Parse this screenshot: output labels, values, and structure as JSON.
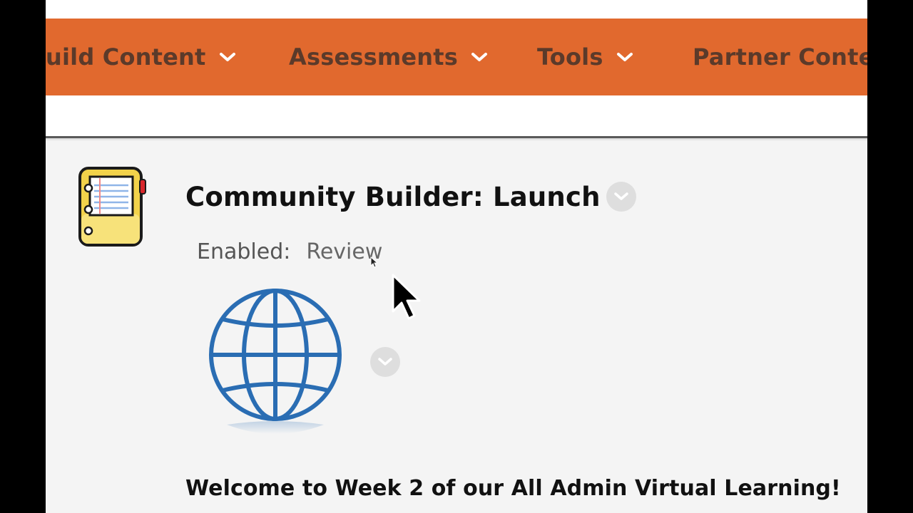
{
  "menu": {
    "items": [
      {
        "label": "uild Content",
        "icon": "chevron-down-icon"
      },
      {
        "label": "Assessments",
        "icon": "chevron-down-icon"
      },
      {
        "label": "Tools",
        "icon": "chevron-down-icon"
      },
      {
        "label": "Partner Conte",
        "icon": "chevron-down-icon"
      }
    ]
  },
  "content_item": {
    "icon": "notebook-icon",
    "title": "Community Builder: Launch",
    "enabled_label": "Enabled:",
    "enabled_value": "Review",
    "image_icon": "globe-icon"
  },
  "body": {
    "welcome": "Welcome to Week 2 of our All Admin Virtual Learning!"
  },
  "colors": {
    "menu_bar": "#e1692e",
    "menu_text": "#5b3a2a",
    "page_background": "#f4f4f4",
    "globe_blue": "#2a6db3",
    "notebook_yellow": "#f2d24a"
  }
}
